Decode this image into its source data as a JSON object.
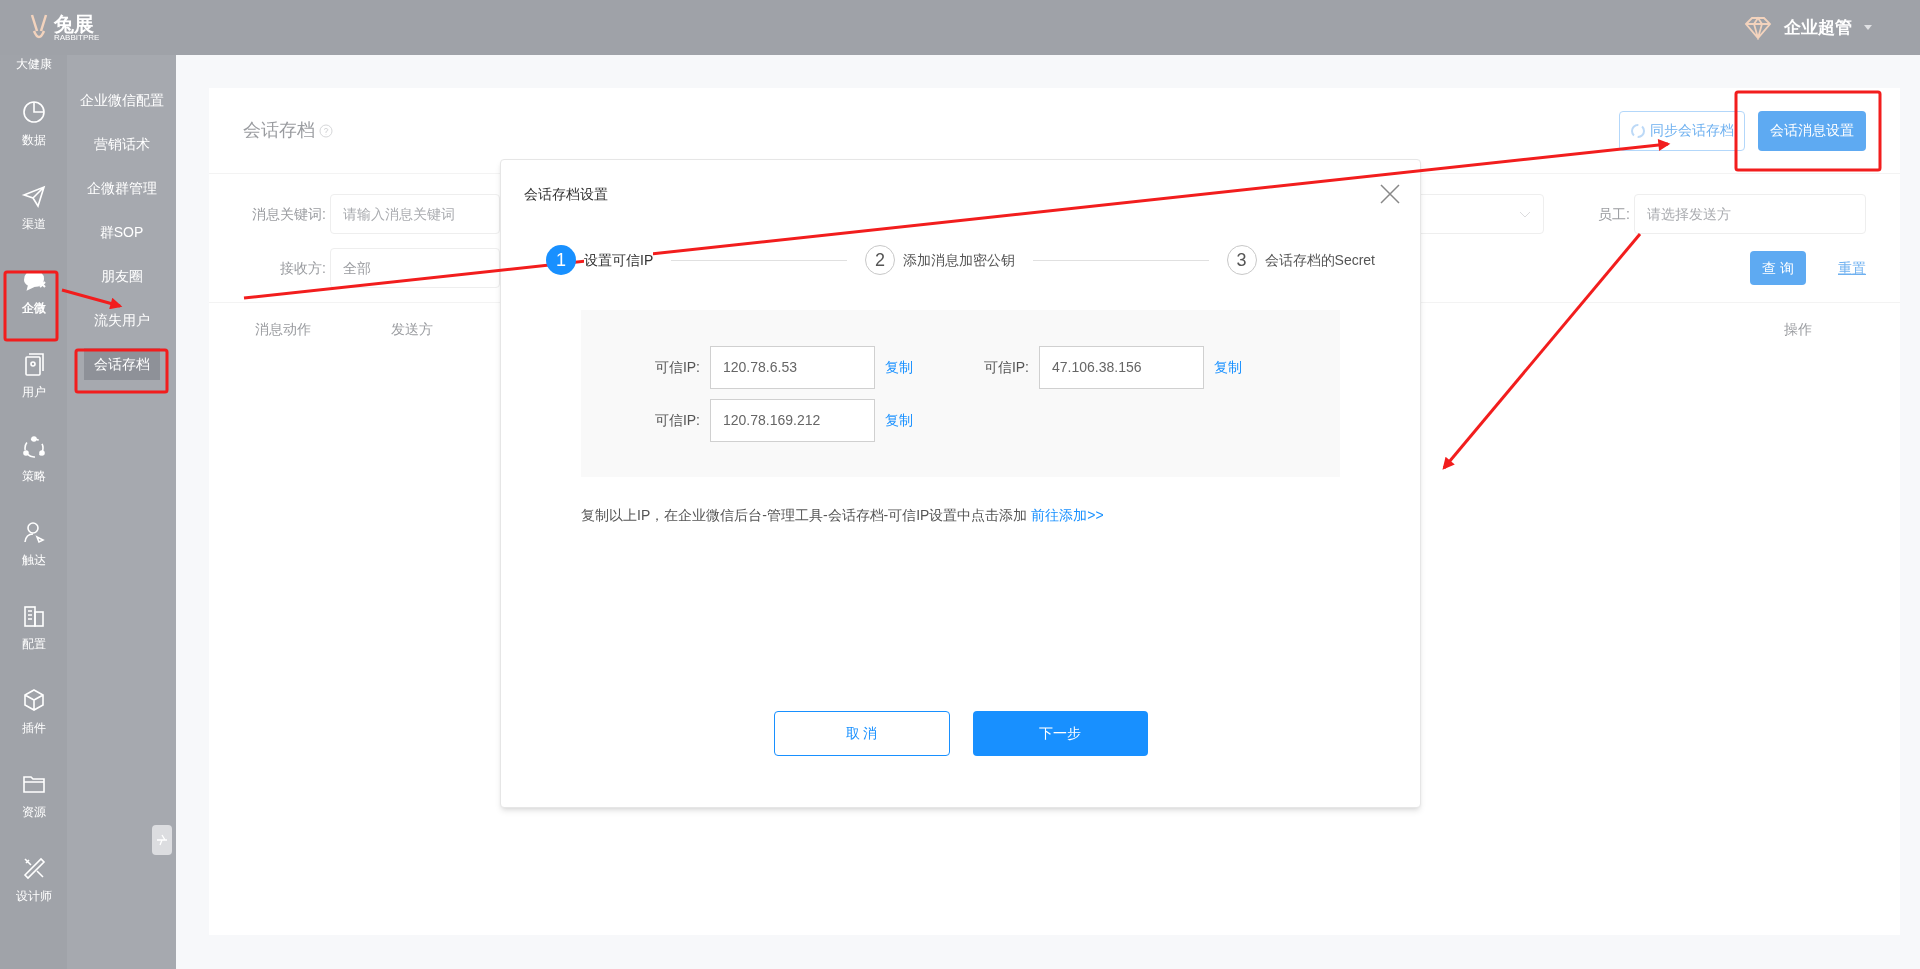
{
  "header": {
    "logo_text": "兔展",
    "logo_subtext": "RABBITPRE",
    "user": "企业超管"
  },
  "rail": {
    "brand_label": "大健康",
    "items": [
      {
        "label": "数据",
        "kind": "chart",
        "selected": false
      },
      {
        "label": "渠道",
        "kind": "plane",
        "selected": false
      },
      {
        "label": "企微",
        "kind": "chat",
        "selected": true
      },
      {
        "label": "用户",
        "kind": "user",
        "selected": false
      },
      {
        "label": "策略",
        "kind": "cycle",
        "selected": false
      },
      {
        "label": "触达",
        "kind": "reach",
        "selected": false
      },
      {
        "label": "配置",
        "kind": "building",
        "selected": false
      },
      {
        "label": "插件",
        "kind": "cube",
        "selected": false
      },
      {
        "label": "资源",
        "kind": "folder",
        "selected": false
      },
      {
        "label": "设计师",
        "kind": "tools",
        "selected": false
      }
    ]
  },
  "submenu": {
    "items": [
      {
        "label": "企业微信配置",
        "selected": false
      },
      {
        "label": "营销话术",
        "selected": false
      },
      {
        "label": "企微群管理",
        "selected": false
      },
      {
        "label": "群SOP",
        "selected": false
      },
      {
        "label": "朋友圈",
        "selected": false
      },
      {
        "label": "流失用户",
        "selected": false
      },
      {
        "label": "会话存档",
        "selected": true
      }
    ]
  },
  "page": {
    "title": "会话存档",
    "sync_button": "同步会话存档",
    "settings_button": "会话消息设置",
    "filters": {
      "keyword_label": "消息关键词:",
      "keyword_placeholder": "请输入消息关键词",
      "receiver_label": "接收方:",
      "receiver_value": "全部",
      "staff_label": "员工:",
      "staff_placeholder": "请选择发送方",
      "query_button": "查 询",
      "reset_link": "重置"
    },
    "table": {
      "columns": [
        "消息动作",
        "发送方",
        "操作"
      ]
    }
  },
  "modal": {
    "title": "会话存档设置",
    "steps": [
      {
        "number": "1",
        "label": "设置可信IP",
        "active": true
      },
      {
        "number": "2",
        "label": "添加消息加密公钥",
        "active": false
      },
      {
        "number": "3",
        "label": "会话存档的Secret",
        "active": false
      }
    ],
    "ips": [
      {
        "label": "可信IP:",
        "value": "120.78.6.53",
        "action": "复制"
      },
      {
        "label": "可信IP:",
        "value": "47.106.38.156",
        "action": "复制"
      },
      {
        "label": "可信IP:",
        "value": "120.78.169.212",
        "action": "复制"
      }
    ],
    "note": "复制以上IP，在企业微信后台-管理工具-会话存档-可信IP设置中点击添加",
    "note_link": "前往添加>>",
    "cancel_button": "取 消",
    "next_button": "下一步"
  }
}
